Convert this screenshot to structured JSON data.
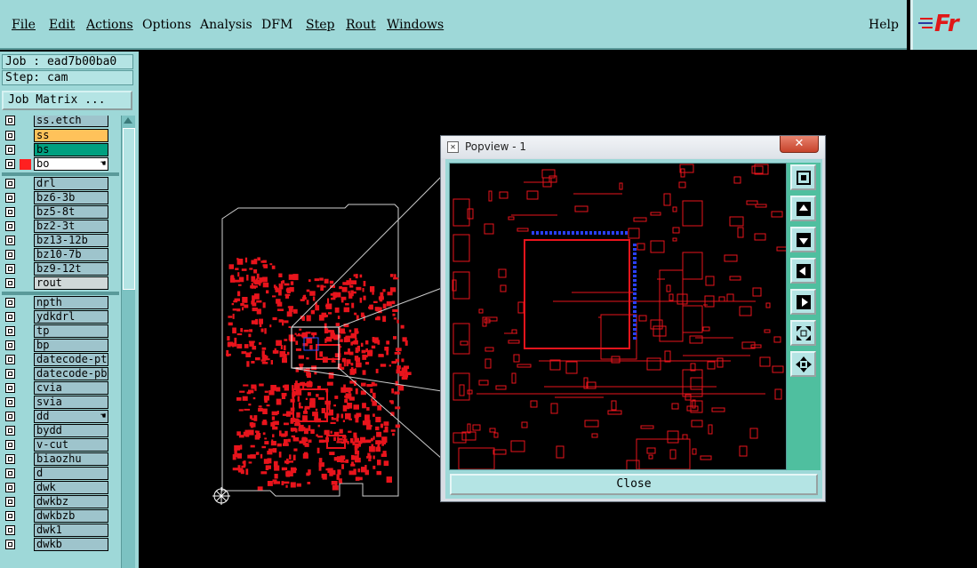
{
  "menubar": {
    "items": [
      "File",
      "Edit",
      "Actions",
      "Options",
      "Analysis",
      "DFM",
      "Step",
      "Rout",
      "Windows"
    ],
    "help_label": "Help"
  },
  "logo": {
    "text": "Fr"
  },
  "left_panel": {
    "job_label": "Job : ead7b00ba0",
    "step_label": "Step: cam",
    "job_matrix_label": "Job Matrix ..."
  },
  "layers": [
    {
      "name": "ss.etch",
      "color": "#9ec4cc"
    },
    {
      "name": "ss",
      "color": "#ffc25a"
    },
    {
      "name": "bs",
      "color": "#00a080"
    },
    {
      "name": "bo",
      "color": "#ffffff",
      "swatch": "#ff2020",
      "hand": true
    },
    {
      "name": "drl",
      "color": "#9ec4cc"
    },
    {
      "name": "bz6-3b",
      "color": "#9ec4cc"
    },
    {
      "name": "bz5-8t",
      "color": "#9ec4cc"
    },
    {
      "name": "bz2-3t",
      "color": "#9ec4cc"
    },
    {
      "name": "bz13-12b",
      "color": "#9ec4cc"
    },
    {
      "name": "bz10-7b",
      "color": "#9ec4cc"
    },
    {
      "name": "bz9-12t",
      "color": "#9ec4cc"
    },
    {
      "name": "rout",
      "color": "#d0d8d8"
    },
    {
      "name": "npth",
      "color": "#9ec4cc"
    },
    {
      "name": "ydkdrl",
      "color": "#9ec4cc"
    },
    {
      "name": "tp",
      "color": "#9ec4cc"
    },
    {
      "name": "bp",
      "color": "#9ec4cc"
    },
    {
      "name": "datecode-ptc",
      "color": "#9ec4cc"
    },
    {
      "name": "datecode-pbc",
      "color": "#9ec4cc"
    },
    {
      "name": "cvia",
      "color": "#9ec4cc"
    },
    {
      "name": "svia",
      "color": "#9ec4cc"
    },
    {
      "name": "dd",
      "color": "#9ec4cc",
      "hand": true
    },
    {
      "name": "bydd",
      "color": "#9ec4cc"
    },
    {
      "name": "v-cut",
      "color": "#9ec4cc"
    },
    {
      "name": "biaozhu",
      "color": "#9ec4cc"
    },
    {
      "name": "d",
      "color": "#9ec4cc"
    },
    {
      "name": "dwk",
      "color": "#9ec4cc"
    },
    {
      "name": "dwkbz",
      "color": "#9ec4cc"
    },
    {
      "name": "dwkbzb",
      "color": "#9ec4cc"
    },
    {
      "name": "dwk1",
      "color": "#9ec4cc"
    },
    {
      "name": "dwkb",
      "color": "#9ec4cc"
    }
  ],
  "popview": {
    "title": "Popview - 1",
    "close_x": "✕",
    "close_label": "Close",
    "tools": [
      "zoom-fit-icon",
      "arrow-up-icon",
      "arrow-down-icon",
      "arrow-left-icon",
      "arrow-right-icon",
      "zoom-in-icon",
      "zoom-out-icon"
    ]
  },
  "colors": {
    "accent": "#9ed8d8",
    "trace": "#e8141c",
    "background": "#000000"
  }
}
